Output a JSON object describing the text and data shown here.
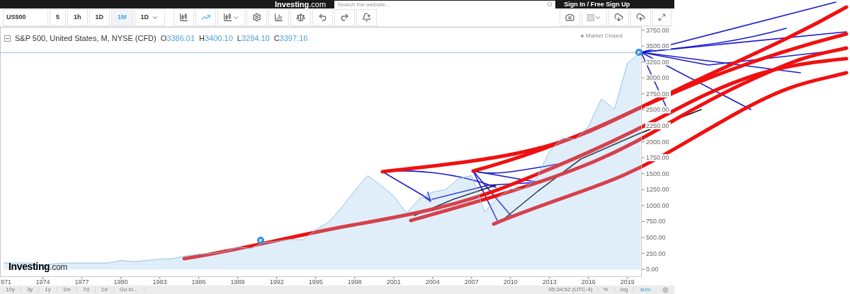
{
  "header": {
    "logo": "Investing",
    "logo_suffix": ".com",
    "search": {
      "placeholder": "Search the website..."
    },
    "sign_in": "Sign In / Free Sign Up"
  },
  "toolbar": {
    "symbol": "US500",
    "intervals": [
      {
        "label": "5",
        "selected": false,
        "kind": "interval"
      },
      {
        "label": "1h",
        "selected": false,
        "kind": "interval"
      },
      {
        "label": "1D",
        "selected": false,
        "kind": "interval"
      },
      {
        "label": "1M",
        "selected": true,
        "kind": "interval"
      },
      {
        "label": "1D",
        "selected": false,
        "kind": "dropdown"
      }
    ]
  },
  "legend": {
    "title_rest": ", United States, M, NYSE (CFD)",
    "ohlc": [
      {
        "key": "O",
        "value": "3386.01"
      },
      {
        "key": "H",
        "value": "3400.10"
      },
      {
        "key": "L",
        "value": "3284.10"
      },
      {
        "key": "C",
        "value": "3397.16"
      }
    ]
  },
  "status": "Market Closed",
  "markers": [
    "P",
    "P"
  ],
  "chart_logo": "Investing",
  "chart_logo_suffix": ".com",
  "x_axis_cut_label": "971",
  "chart_data": {
    "type": "area",
    "x": [
      1971,
      1972,
      1973,
      1974,
      1975,
      1976,
      1977,
      1978,
      1979,
      1980,
      1981,
      1982,
      1983,
      1984,
      1985,
      1986,
      1987,
      1988,
      1989,
      1990,
      1991,
      1992,
      1993,
      1994,
      1995,
      1996,
      1997,
      1998,
      1999,
      2000,
      2001,
      2002,
      2003,
      2004,
      2005,
      2006,
      2007,
      2008,
      2009,
      2010,
      2011,
      2012,
      2013,
      2014,
      2015,
      2016,
      2017,
      2018,
      2019,
      2020
    ],
    "series": [
      {
        "name": "S&P 500",
        "color": "#8fc3ea",
        "values": [
          100,
          100,
          100,
          70,
          90,
          100,
          100,
          100,
          100,
          140,
          120,
          140,
          160,
          170,
          210,
          240,
          250,
          280,
          350,
          330,
          420,
          440,
          470,
          460,
          620,
          740,
          970,
          1230,
          1470,
          1320,
          1150,
          880,
          1110,
          1210,
          1250,
          1420,
          1470,
          900,
          1120,
          1260,
          1260,
          1430,
          1850,
          2060,
          2040,
          2240,
          2670,
          2510,
          3230,
          3400
        ]
      }
    ],
    "xlim": [
      1970.7,
      2020.1
    ],
    "ylim": [
      -120,
      3800
    ],
    "xticks": [
      1974,
      1977,
      1980,
      1983,
      1986,
      1989,
      1992,
      1995,
      1998,
      2001,
      2004,
      2007,
      2010,
      2013,
      2016,
      2019
    ],
    "yticks": [
      {
        "value": 0,
        "label": "0.00"
      },
      {
        "value": 250,
        "label": "250.00"
      },
      {
        "value": 500,
        "label": "500.00"
      },
      {
        "value": 750,
        "label": "750.00"
      },
      {
        "value": 1000,
        "label": "1000.00"
      },
      {
        "value": 1250,
        "label": "1250.00"
      },
      {
        "value": 1500,
        "label": "1500.00"
      },
      {
        "value": 1750,
        "label": "1750.00"
      },
      {
        "value": 2000,
        "label": "2000.00"
      },
      {
        "value": 2250,
        "label": "2250.00"
      },
      {
        "value": 2500,
        "label": "2500.00"
      },
      {
        "value": 2750,
        "label": "2750.00"
      },
      {
        "value": 3000,
        "label": "3000.00"
      },
      {
        "value": 3250,
        "label": "3250.00"
      },
      {
        "value": 3500,
        "label": "3500.00"
      },
      {
        "value": 3750,
        "label": "3750.00"
      }
    ]
  },
  "bottom_bar": {
    "ranges": [
      "10y",
      "3y",
      "1y",
      "1m",
      "7d",
      "1d",
      "Go to..."
    ],
    "time": "05:34:52 (UTC-4)",
    "options": [
      {
        "label": "%",
        "selected": false
      },
      {
        "label": "log",
        "selected": false
      },
      {
        "label": "auto",
        "selected": true
      }
    ]
  }
}
